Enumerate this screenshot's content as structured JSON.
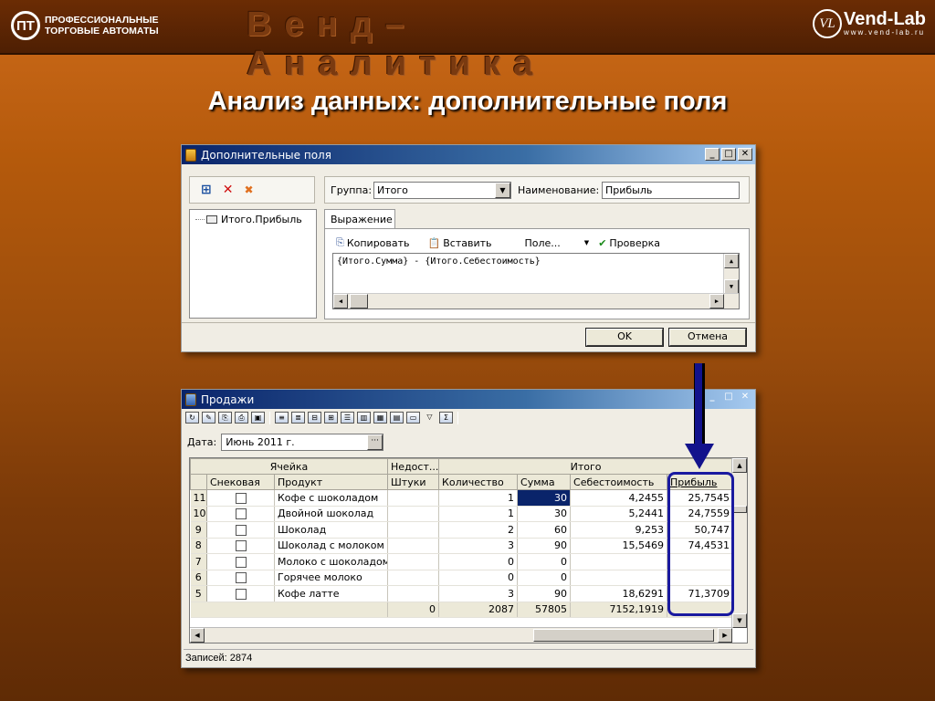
{
  "slide": {
    "brand_left_line1": "ПРОФЕССИОНАЛЬНЫЕ",
    "brand_left_line2": "ТОРГОВЫЕ АВТОМАТЫ",
    "brand_title": "Венд–Аналитика",
    "brand_right_name": "Vend-Lab",
    "brand_right_url": "www.vend-lab.ru",
    "brand_right_mark": "VL",
    "title": "Анализ данных: дополнительные поля"
  },
  "dialog": {
    "title": "Дополнительные поля",
    "tree_item": "Итого.Прибыль",
    "group_label": "Группа:",
    "group_value": "Итого",
    "name_label": "Наименование:",
    "name_value": "Прибыль",
    "tab_label": "Выражение",
    "copy_label": "Копировать",
    "paste_label": "Вставить",
    "field_label": "Поле...",
    "check_label": "Проверка",
    "expression": "{Итого.Сумма} - {Итого.Себестоимость}",
    "ok_label": "OK",
    "cancel_label": "Отмена"
  },
  "sales": {
    "title": "Продажи",
    "date_label": "Дата:",
    "date_value": "Июнь 2011 г.",
    "group_headers": [
      "Ячейка",
      "Недост...",
      "Итого"
    ],
    "columns": [
      "Снековая",
      "Продукт",
      "Штуки",
      "Количество",
      "Сумма",
      "Себестоимость",
      "Прибыль"
    ],
    "rows": [
      {
        "n": "11",
        "product": "Кофе с шоколадом",
        "qty": "1",
        "sum": "30",
        "cost": "4,2455",
        "profit": "25,7545"
      },
      {
        "n": "10",
        "product": "Двойной шоколад",
        "qty": "1",
        "sum": "30",
        "cost": "5,2441",
        "profit": "24,7559"
      },
      {
        "n": "9",
        "product": "Шоколад",
        "qty": "2",
        "sum": "60",
        "cost": "9,253",
        "profit": "50,747"
      },
      {
        "n": "8",
        "product": "Шоколад с молоком",
        "qty": "3",
        "sum": "90",
        "cost": "15,5469",
        "profit": "74,4531"
      },
      {
        "n": "7",
        "product": "Молоко с шоколадом",
        "qty": "0",
        "sum": "0",
        "cost": "",
        "profit": ""
      },
      {
        "n": "6",
        "product": "Горячее молоко",
        "qty": "0",
        "sum": "0",
        "cost": "",
        "profit": ""
      },
      {
        "n": "5",
        "product": "Кофе латте",
        "qty": "3",
        "sum": "90",
        "cost": "18,6291",
        "profit": "71,3709"
      }
    ],
    "totals": {
      "pieces": "0",
      "qty": "2087",
      "sum": "57805",
      "cost": "7152,1919"
    },
    "records": "Записей: 2874"
  }
}
